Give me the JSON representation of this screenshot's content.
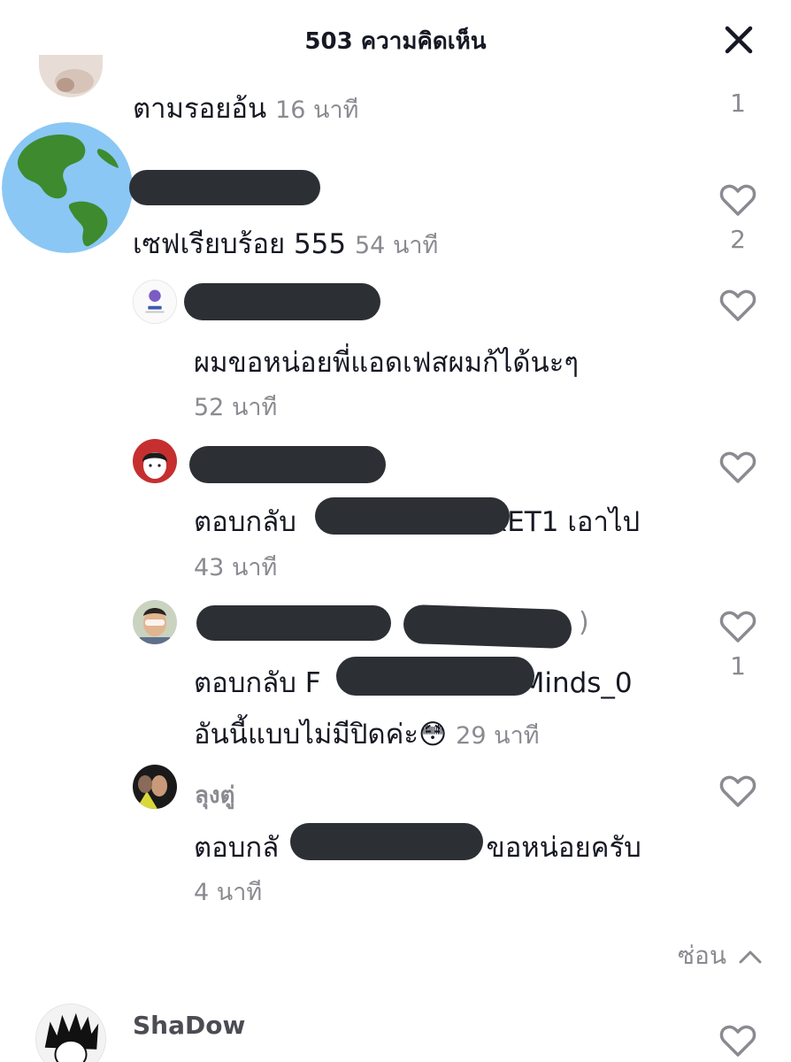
{
  "header": {
    "title": "503 ความคิดเห็น",
    "close_icon": "close-icon"
  },
  "comments": [
    {
      "text": "ตามรอยอ้น",
      "time": "16 นาที",
      "likes": "1"
    },
    {
      "text": "เซฟเรียบร้อย 555",
      "time": "54 นาที",
      "likes": "2",
      "avatar": "globe-icon"
    },
    {
      "text": "ผมขอหน่อยพี่แอดเฟสผมก้ได้นะๆ",
      "time": "52 นาที"
    },
    {
      "reply_prefix": "ตอบกลับ",
      "reply_suffix": "xET1 เอาไป",
      "time": "43 นาที"
    },
    {
      "name_end": ")",
      "reply_prefix": "ตอบกลับ",
      "reply_mid": "F",
      "reply_suffix": "Minds_0",
      "line2": "อันนี้แบบไม่มีปิดค่ะ😳",
      "time": "29 นาที",
      "likes": "1"
    },
    {
      "username": "ลุงตู่",
      "reply_prefix": "ตอบกลั",
      "reply_suffix": ": ขอหน่อยครับ",
      "time": "4 นาที"
    }
  ],
  "hide_label": "ซ่อน",
  "last_comment": {
    "username": "ShaDow"
  },
  "colors": {
    "redaction": "#2c3035",
    "secondary_text": "#8a8b91",
    "primary_text": "#161823"
  }
}
